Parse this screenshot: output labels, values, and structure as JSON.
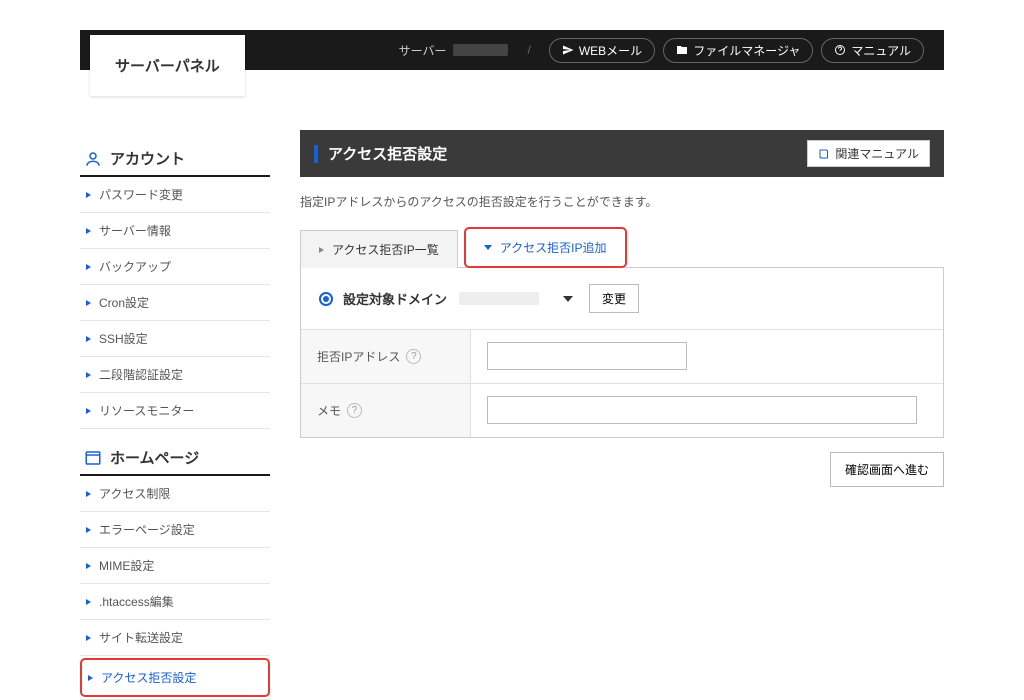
{
  "header": {
    "logo": "サーバーパネル",
    "server_label": "サーバー",
    "webmail": "WEBメール",
    "filemgr": "ファイルマネージャ",
    "manual": "マニュアル"
  },
  "sidebar": {
    "account": {
      "title": "アカウント",
      "items": [
        "パスワード変更",
        "サーバー情報",
        "バックアップ",
        "Cron設定",
        "SSH設定",
        "二段階認証設定",
        "リソースモニター"
      ]
    },
    "homepage": {
      "title": "ホームページ",
      "items": [
        "アクセス制限",
        "エラーページ設定",
        "MIME設定",
        ".htaccess編集",
        "サイト転送設定",
        "アクセス拒否設定"
      ]
    }
  },
  "main": {
    "title": "アクセス拒否設定",
    "related_manual": "関連マニュアル",
    "desc": "指定IPアドレスからのアクセスの拒否設定を行うことができます。",
    "tabs": {
      "list": "アクセス拒否IP一覧",
      "add": "アクセス拒否IP追加"
    },
    "domain_label": "設定対象ドメイン",
    "change_btn": "変更",
    "ip_label": "拒否IPアドレス",
    "memo_label": "メモ",
    "proceed": "確認画面へ進む"
  }
}
